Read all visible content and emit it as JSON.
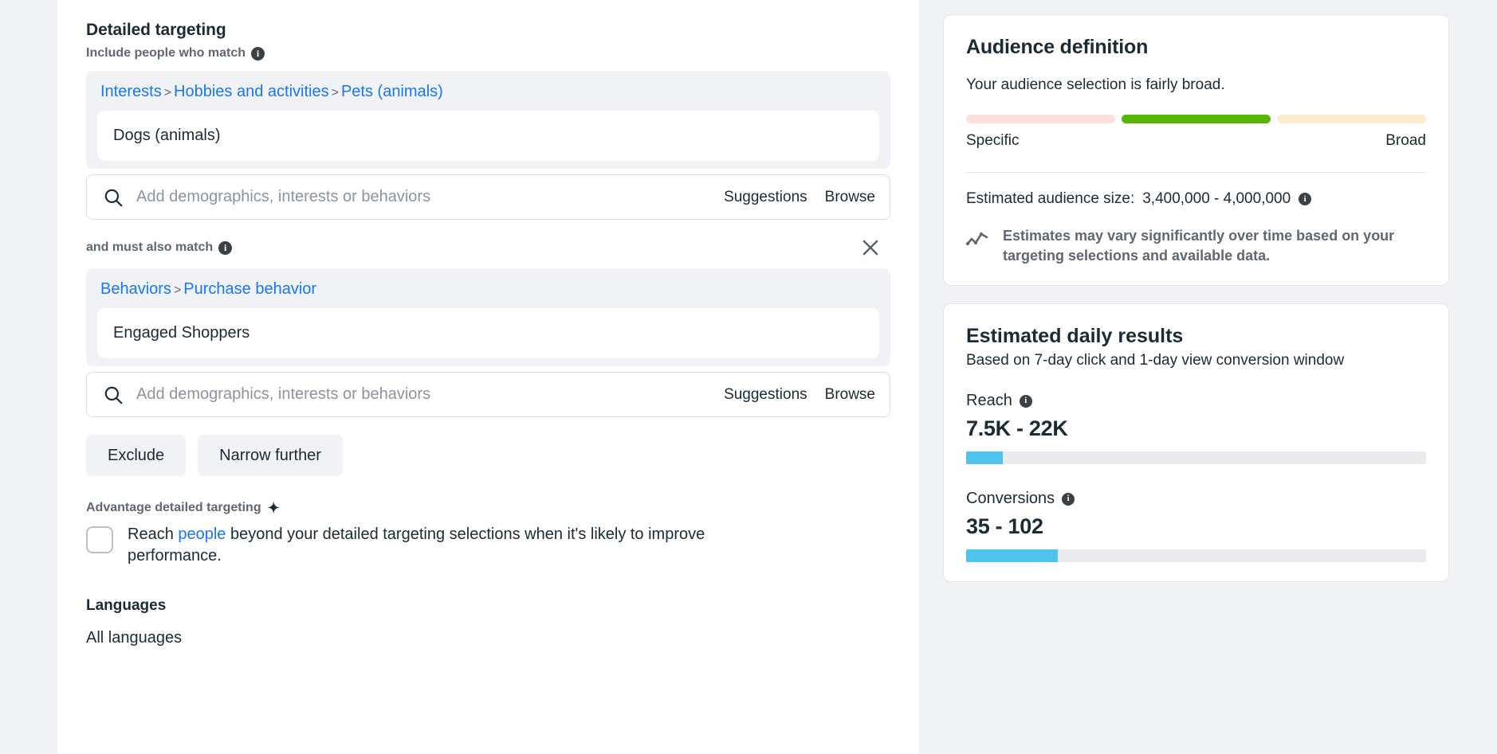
{
  "left": {
    "section_title": "Detailed targeting",
    "include_label": "Include people who match",
    "info_icon": "info-icon",
    "group1": {
      "breadcrumb": [
        "Interests",
        "Hobbies and activities",
        "Pets (animals)"
      ],
      "separator": ">",
      "chip": "Dogs (animals)"
    },
    "search1": {
      "icon": "search-icon",
      "placeholder": "Add demographics, interests or behaviors",
      "suggestions_label": "Suggestions",
      "browse_label": "Browse"
    },
    "also_match_label": "and must also match",
    "close_icon": "close-icon",
    "group2": {
      "breadcrumb": [
        "Behaviors",
        "Purchase behavior"
      ],
      "separator": ">",
      "chip": "Engaged Shoppers"
    },
    "search2": {
      "icon": "search-icon",
      "placeholder": "Add demographics, interests or behaviors",
      "suggestions_label": "Suggestions",
      "browse_label": "Browse"
    },
    "exclude_button": "Exclude",
    "narrow_button": "Narrow further",
    "advantage": {
      "title": "Advantage detailed targeting",
      "sparkle": "✦",
      "text_before": "Reach ",
      "link": "people",
      "text_after": " beyond your detailed targeting selections when it's likely to improve performance.",
      "checked": false
    },
    "languages": {
      "title": "Languages",
      "value": "All languages"
    }
  },
  "right": {
    "audience": {
      "title": "Audience definition",
      "description": "Your audience selection is fairly broad.",
      "gauge": [
        {
          "name": "specific",
          "color": "#fbe0db"
        },
        {
          "name": "broad-active",
          "color": "#56b505"
        },
        {
          "name": "very-broad",
          "color": "#fbeccd"
        }
      ],
      "label_left": "Specific",
      "label_right": "Broad",
      "estimate_label": "Estimated audience size:",
      "estimate_value": "3,400,000 - 4,000,000",
      "note_icon": "trend-line-icon",
      "note": "Estimates may vary significantly over time based on your targeting selections and available data."
    },
    "daily": {
      "title": "Estimated daily results",
      "subtitle": "Based on 7-day click and 1-day view conversion window",
      "metrics": [
        {
          "label": "Reach",
          "value": "7.5K - 22K",
          "fill_percent": 8,
          "bar_color": "#4fc3ee"
        },
        {
          "label": "Conversions",
          "value": "35 - 102",
          "fill_percent": 20,
          "bar_color": "#4fc3ee"
        }
      ]
    }
  }
}
